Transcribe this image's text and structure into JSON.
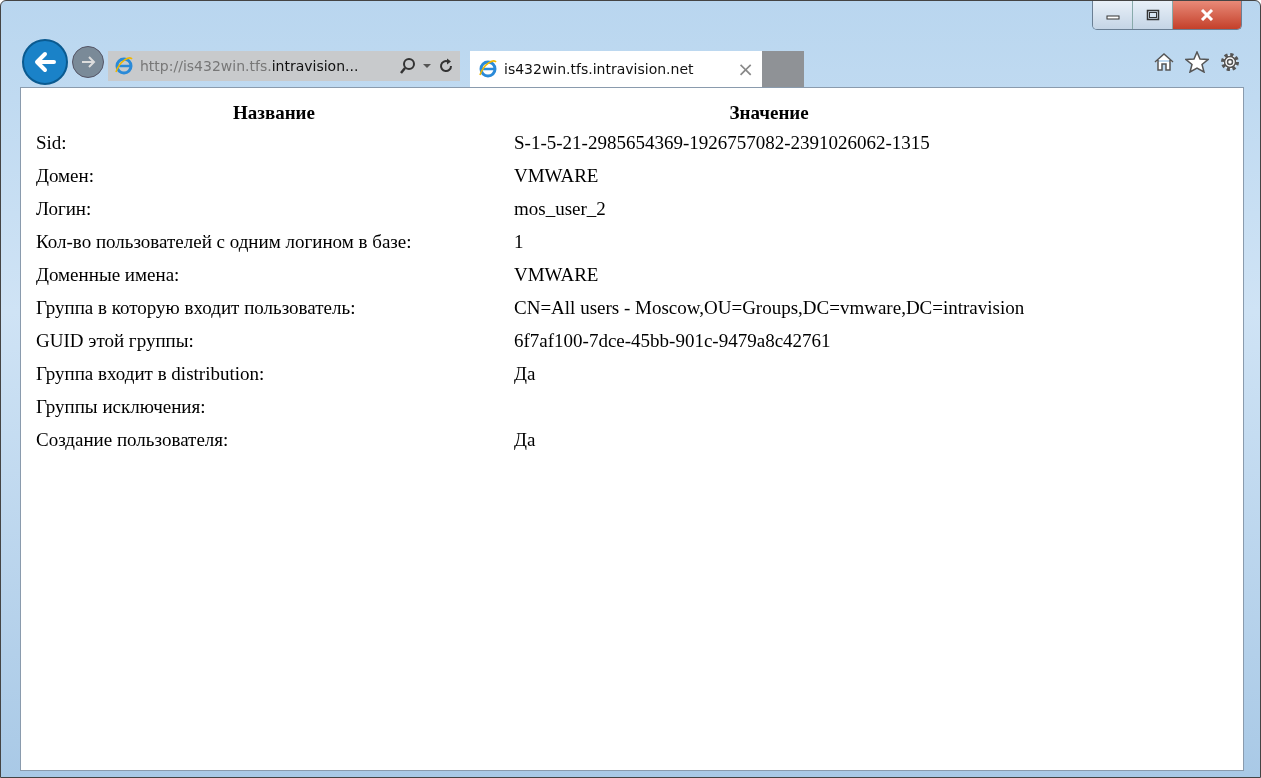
{
  "address_bar": {
    "dim_text": "http://is432win.tfs.",
    "main_text": "intravision..."
  },
  "tab": {
    "title": "is432win.tfs.intravision.net",
    "close": "×"
  },
  "table": {
    "columns": [
      "Название",
      "Значение"
    ],
    "rows": [
      {
        "name": "Sid:",
        "value": "S-1-5-21-2985654369-1926757082-2391026062-1315"
      },
      {
        "name": "Домен:",
        "value": "VMWARE"
      },
      {
        "name": "Логин:",
        "value": "mos_user_2"
      },
      {
        "name": "Кол-во пользователей с одним логином в базе:",
        "value": "1"
      },
      {
        "name": "Доменные имена:",
        "value": "VMWARE"
      },
      {
        "name": "Группа в которую входит пользователь:",
        "value": "CN=All users - Moscow,OU=Groups,DC=vmware,DC=intravision"
      },
      {
        "name": "GUID этой группы:",
        "value": "6f7af100-7dce-45bb-901c-9479a8c42761"
      },
      {
        "name": "Группа входит в distribution:",
        "value": "Да"
      },
      {
        "name": "Группы исключения:",
        "value": ""
      },
      {
        "name": "Создание пользователя:",
        "value": "Да"
      }
    ]
  }
}
